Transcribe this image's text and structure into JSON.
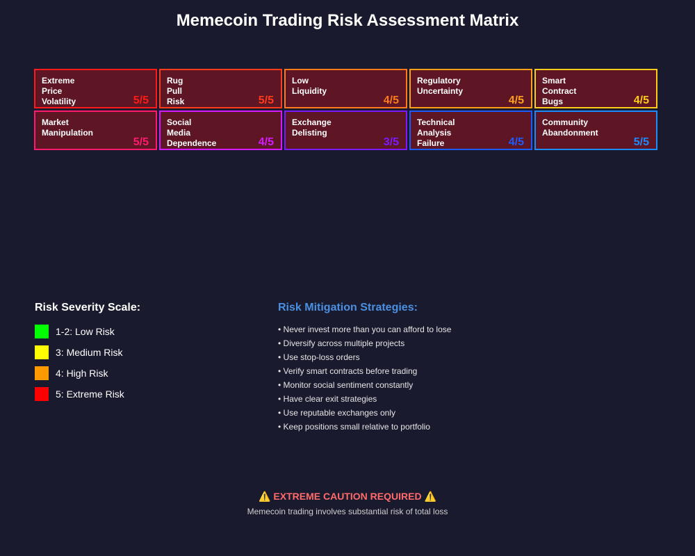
{
  "title": "Memecoin Trading Risk Assessment Matrix",
  "risks": [
    {
      "label": "Extreme\nPrice\nVolatility",
      "score": "5/5",
      "color": "#ff1a1a"
    },
    {
      "label": "Rug\nPull\nRisk",
      "score": "5/5",
      "color": "#ff3b1a"
    },
    {
      "label": "Low\nLiquidity",
      "score": "4/5",
      "color": "#ff7a1a"
    },
    {
      "label": "Regulatory\nUncertainty",
      "score": "4/5",
      "color": "#ffa01a"
    },
    {
      "label": "Smart\nContract\nBugs",
      "score": "4/5",
      "color": "#ffcc1a"
    },
    {
      "label": "Market\nManipulation",
      "score": "5/5",
      "color": "#ff1a6e"
    },
    {
      "label": "Social\nMedia\nDependence",
      "score": "4/5",
      "color": "#d41aff"
    },
    {
      "label": "Exchange\nDelisting",
      "score": "3/5",
      "color": "#7a1aff"
    },
    {
      "label": "Technical\nAnalysis\nFailure",
      "score": "4/5",
      "color": "#1a5cff"
    },
    {
      "label": "Community\nAbandonment",
      "score": "5/5",
      "color": "#1a8cff"
    }
  ],
  "legend": {
    "title": "Risk Severity Scale:",
    "items": [
      {
        "label": "1-2: Low Risk",
        "color": "#00ff00"
      },
      {
        "label": "3: Medium Risk",
        "color": "#ffff00"
      },
      {
        "label": "4: High Risk",
        "color": "#ff9900"
      },
      {
        "label": "5: Extreme Risk",
        "color": "#ff0000"
      }
    ]
  },
  "mitigation": {
    "title": "Risk Mitigation Strategies:",
    "items": [
      "• Never invest more than you can afford to lose",
      "• Diversify across multiple projects",
      "• Use stop-loss orders",
      "• Verify smart contracts before trading",
      "• Monitor social sentiment constantly",
      "• Have clear exit strategies",
      "• Use reputable exchanges only",
      "• Keep positions small relative to portfolio"
    ]
  },
  "warning": "⚠️ EXTREME CAUTION REQUIRED ⚠️",
  "subtext": "Memecoin trading involves substantial risk of total loss"
}
